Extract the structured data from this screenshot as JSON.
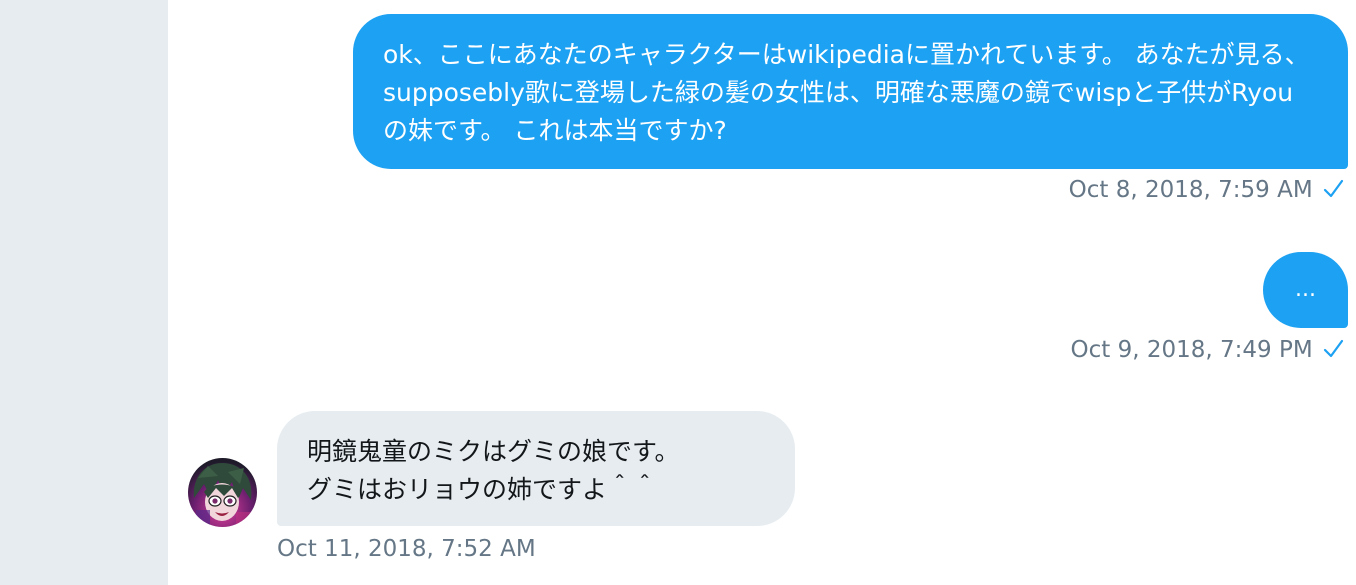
{
  "colors": {
    "accent": "#1da1f2",
    "incoming_bubble": "#e6ecf0",
    "meta_text": "#657786",
    "rail": "#e6ecf0"
  },
  "messages": [
    {
      "direction": "outgoing",
      "text": "ok、ここにあなたのキャラクターはwikipediaに置かれています。 あなたが見る、supposebly歌に登場した緑の髪の女性は、明確な悪魔の鏡でwispと子供がRyouの妹です。 これは本当ですか?",
      "timestamp": "Oct 8, 2018, 7:59 AM",
      "status_icon": "checkmark-icon"
    },
    {
      "direction": "outgoing",
      "text": "...",
      "timestamp": "Oct 9, 2018, 7:49 PM",
      "status_icon": "checkmark-icon"
    },
    {
      "direction": "incoming",
      "text": "明鏡鬼童のミクはグミの娘です。\nグミはおリョウの姉ですよ＾＾",
      "timestamp": "Oct 11, 2018, 7:52 AM",
      "avatar_icon": "avatar-anime-character"
    }
  ]
}
